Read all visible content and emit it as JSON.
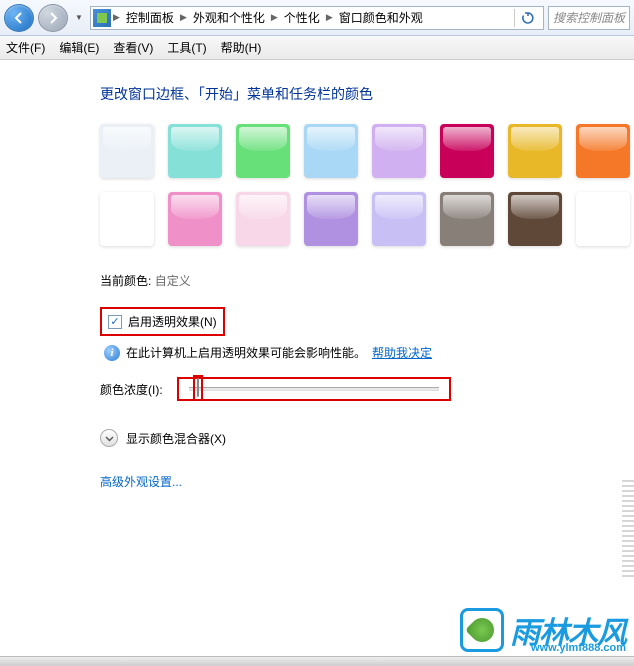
{
  "nav": {
    "crumbs": [
      "控制面板",
      "外观和个性化",
      "个性化",
      "窗口颜色和外观"
    ],
    "search_placeholder": "搜索控制面板"
  },
  "menu": {
    "items": [
      "文件(F)",
      "编辑(E)",
      "查看(V)",
      "工具(T)",
      "帮助(H)"
    ]
  },
  "heading": "更改窗口边框、「开始」菜单和任务栏的颜色",
  "swatches_row1": [
    "#eaf0f6",
    "#85e0d8",
    "#68e07a",
    "#a8d8f5",
    "#d0b0f0",
    "#c8005a",
    "#e8b828",
    "#f57828"
  ],
  "swatches_row2": [
    "#ffffff",
    "#f090c8",
    "#f8d8e8",
    "#b090e0",
    "#c8c0f5",
    "#888078",
    "#604838",
    "#ffffff"
  ],
  "current_color": {
    "label": "当前颜色:",
    "value": "自定义"
  },
  "transparency": {
    "label": "启用透明效果(N)",
    "checked": true
  },
  "info": {
    "text": "在此计算机上启用透明效果可能会影响性能。",
    "link": "帮助我决定"
  },
  "intensity": {
    "label": "颜色浓度(I):"
  },
  "mixer": {
    "label": "显示颜色混合器(X)"
  },
  "advanced": {
    "label": "高级外观设置..."
  },
  "watermark": {
    "text": "雨林木风",
    "url": "www.ylmf888.com"
  }
}
